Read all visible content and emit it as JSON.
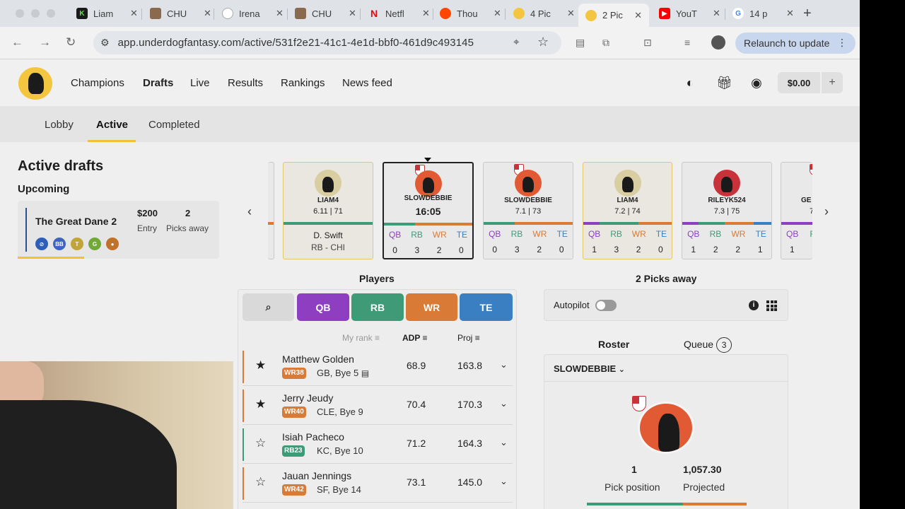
{
  "browser": {
    "tabs": [
      {
        "title": "Liam",
        "favicon": "K"
      },
      {
        "title": "CHU",
        "favicon": "image"
      },
      {
        "title": "Irena",
        "favicon": "globe"
      },
      {
        "title": "CHU",
        "favicon": "image"
      },
      {
        "title": "Netfl",
        "favicon": "N"
      },
      {
        "title": "Thou",
        "favicon": "reddit"
      },
      {
        "title": "4 Pic",
        "favicon": "underdog"
      },
      {
        "title": "2 Pic",
        "favicon": "underdog",
        "active": true
      },
      {
        "title": "YouT",
        "favicon": "youtube"
      },
      {
        "title": "14 p",
        "favicon": "G"
      }
    ],
    "url": "app.underdogfantasy.com/active/531f2e21-41c1-4e1d-bbf0-461d9c493145",
    "relaunch_label": "Relaunch to update"
  },
  "header": {
    "nav": [
      "Champions",
      "Drafts",
      "Live",
      "Results",
      "Rankings",
      "News feed"
    ],
    "active_nav": "Drafts",
    "balance": "$0.00"
  },
  "subnav": {
    "tabs": [
      "Lobby",
      "Active",
      "Completed"
    ],
    "active": "Active"
  },
  "sidebar": {
    "title": "Active drafts",
    "section": "Upcoming",
    "draft": {
      "name": "The Great Dane 2",
      "entry_value": "$200",
      "entry_label": "Entry",
      "picks_value": "2",
      "picks_label": "Picks away",
      "badges": [
        "football",
        "BB",
        "T",
        "G",
        "basketball"
      ]
    }
  },
  "carousel": [
    {
      "type": "pick",
      "name": "LIAM4",
      "stat": "6.11 | 71",
      "player": "D. Swift",
      "team": "RB - CHI"
    },
    {
      "type": "current",
      "name": "SLOWDEBBIE",
      "timer": "16:05",
      "positions": [
        "QB",
        "RB",
        "WR",
        "TE"
      ],
      "counts": [
        "0",
        "3",
        "2",
        "0"
      ]
    },
    {
      "type": "other",
      "name": "SLOWDEBBIE",
      "stat": "7.1 | 73",
      "positions": [
        "QB",
        "RB",
        "WR",
        "TE"
      ],
      "counts": [
        "0",
        "3",
        "2",
        "0"
      ]
    },
    {
      "type": "user",
      "name": "LIAM4",
      "stat": "7.2 | 74",
      "positions": [
        "QB",
        "RB",
        "WR",
        "TE"
      ],
      "counts": [
        "1",
        "3",
        "2",
        "0"
      ]
    },
    {
      "type": "other",
      "name": "RILEYK524",
      "stat": "7.3 | 75",
      "positions": [
        "QB",
        "RB",
        "WR",
        "TE"
      ],
      "counts": [
        "1",
        "2",
        "2",
        "1"
      ]
    },
    {
      "type": "partial",
      "name": "GE",
      "stat": "7",
      "positions": [
        "QB",
        "R"
      ],
      "counts": [
        "1"
      ]
    }
  ],
  "players": {
    "title": "Players",
    "filters": [
      "QB",
      "RB",
      "WR",
      "TE"
    ],
    "columns": {
      "rank": "My rank",
      "adp": "ADP",
      "proj": "Proj"
    },
    "rows": [
      {
        "name": "Matthew Golden",
        "rank": "WR38",
        "team": "GB, Bye 5",
        "adp": "68.9",
        "proj": "163.8",
        "starred": true,
        "pos": "WR",
        "note": true
      },
      {
        "name": "Jerry Jeudy",
        "rank": "WR40",
        "team": "CLE, Bye 9",
        "adp": "70.4",
        "proj": "170.3",
        "starred": true,
        "pos": "WR"
      },
      {
        "name": "Isiah Pacheco",
        "rank": "RB23",
        "team": "KC, Bye 10",
        "adp": "71.2",
        "proj": "164.3",
        "starred": false,
        "pos": "RB"
      },
      {
        "name": "Jauan Jennings",
        "rank": "WR42",
        "team": "SF, Bye 14",
        "adp": "73.1",
        "proj": "145.0",
        "starred": false,
        "pos": "WR"
      }
    ]
  },
  "right_panel": {
    "picks_away": "2 Picks away",
    "autopilot_label": "Autopilot",
    "roster_tab": "Roster",
    "queue_tab": "Queue",
    "queue_count": "3",
    "roster_user": "SLOWDEBBIE",
    "pick_position": "1",
    "pick_position_label": "Pick position",
    "projected": "1,057.30",
    "projected_label": "Projected"
  },
  "colors": {
    "qb": "#8e3fc1",
    "rb": "#3f9a78",
    "wr": "#d97b36",
    "te": "#3a7fc1",
    "accent": "#f2c034"
  }
}
